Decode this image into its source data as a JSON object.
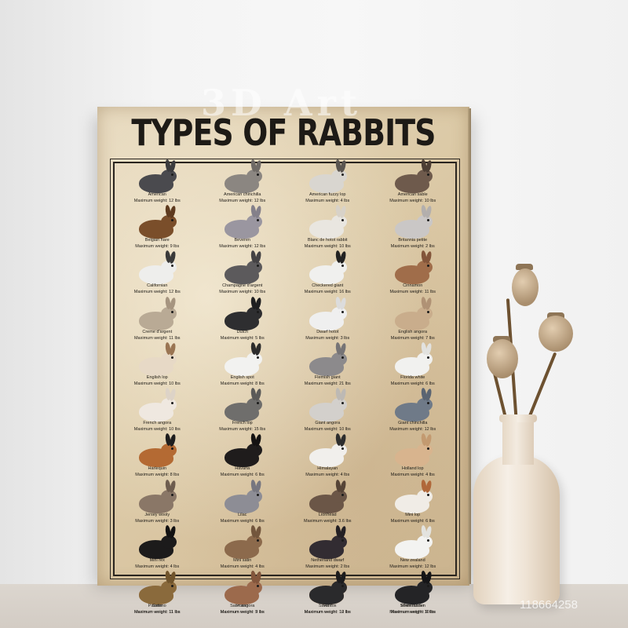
{
  "poster": {
    "title": "TYPES OF RABBITS",
    "rabbits": [
      {
        "name": "American",
        "weight": "Maximum weight: 12 lbs",
        "color": "#4a4a4e",
        "ear": "#3b3b3e"
      },
      {
        "name": "American chinchilla",
        "weight": "Maximum weight: 12 lbs",
        "color": "#8b8681",
        "ear": "#6f6a66"
      },
      {
        "name": "American fuzzy lop",
        "weight": "Maximum weight: 4 lbs",
        "color": "#d9d6d0",
        "ear": "#5a5550"
      },
      {
        "name": "American sable",
        "weight": "Maximum weight: 10 lbs",
        "color": "#6e5a4c",
        "ear": "#4c3e34"
      },
      {
        "name": "Belgian hare",
        "weight": "Maximum weight: 9 lbs",
        "color": "#7a4e2a",
        "ear": "#5e3a1e"
      },
      {
        "name": "Beveren",
        "weight": "Maximum weight: 12 lbs",
        "color": "#9a96a0",
        "ear": "#84808a"
      },
      {
        "name": "Blanc de hotot rabbit",
        "weight": "Maximum weight: 10 lbs",
        "color": "#e9e6e0",
        "ear": "#d8d2c8"
      },
      {
        "name": "Britannia petite",
        "weight": "Maximum weight: 2 lbs",
        "color": "#cac7c6",
        "ear": "#b3afad"
      },
      {
        "name": "Californian",
        "weight": "Maximum weight: 12 lbs",
        "color": "#eeeeec",
        "ear": "#3a3a3a"
      },
      {
        "name": "Champagne d'argent",
        "weight": "Maximum weight: 10 lbs",
        "color": "#5c5a5c",
        "ear": "#444244"
      },
      {
        "name": "Checkered giant",
        "weight": "Maximum weight: 16 lbs",
        "color": "#f0f0ee",
        "ear": "#222222"
      },
      {
        "name": "Cinnamon",
        "weight": "Maximum weight: 11 lbs",
        "color": "#a06d4a",
        "ear": "#83553a"
      },
      {
        "name": "Creme d'argent",
        "weight": "Maximum weight: 11 lbs",
        "color": "#b9aa95",
        "ear": "#a69580"
      },
      {
        "name": "Dutch",
        "weight": "Maximum weight: 5 lbs",
        "color": "#2e2e30",
        "ear": "#1f1f20"
      },
      {
        "name": "Dwarf hotot",
        "weight": "Maximum weight: 3 lbs",
        "color": "#efefef",
        "ear": "#dcdcdc"
      },
      {
        "name": "English angora",
        "weight": "Maximum weight: 7 lbs",
        "color": "#c9ad8c",
        "ear": "#b09275"
      },
      {
        "name": "English lop",
        "weight": "Maximum weight: 10 lbs",
        "color": "#e7d9c6",
        "ear": "#9a7553"
      },
      {
        "name": "English spot",
        "weight": "Maximum weight: 8 lbs",
        "color": "#f2f2f0",
        "ear": "#2c2c2c"
      },
      {
        "name": "Flemish giant",
        "weight": "Maximum weight: 21 lbs",
        "color": "#8c8a8c",
        "ear": "#767476"
      },
      {
        "name": "Florida white",
        "weight": "Maximum weight: 6 lbs",
        "color": "#f1f1ef",
        "ear": "#e2e2df"
      },
      {
        "name": "French angora",
        "weight": "Maximum weight: 10 lbs",
        "color": "#efe8e0",
        "ear": "#ddd3c7"
      },
      {
        "name": "French lop",
        "weight": "Maximum weight: 15 lbs",
        "color": "#6f6e6c",
        "ear": "#5b5a58"
      },
      {
        "name": "Giant angora",
        "weight": "Maximum weight: 10 lbs",
        "color": "#d3d0cc",
        "ear": "#bdb9b4"
      },
      {
        "name": "Giant chinchilla",
        "weight": "Maximum weight: 12 lbs",
        "color": "#6f7a88",
        "ear": "#5a6472"
      },
      {
        "name": "Harlequin",
        "weight": "Maximum weight: 8 lbs",
        "color": "#b46a33",
        "ear": "#1e1e1e"
      },
      {
        "name": "Havana",
        "weight": "Maximum weight: 6 lbs",
        "color": "#1f1c1c",
        "ear": "#141212"
      },
      {
        "name": "Himalayan",
        "weight": "Maximum weight: 4 lbs",
        "color": "#f1efec",
        "ear": "#2e2e2e"
      },
      {
        "name": "Holland lop",
        "weight": "Maximum weight: 4 lbs",
        "color": "#d8b48e",
        "ear": "#c39a70"
      },
      {
        "name": "Jersey wooly",
        "weight": "Maximum weight: 3 lbs",
        "color": "#8a7767",
        "ear": "#6e5d4f"
      },
      {
        "name": "Lilac",
        "weight": "Maximum weight: 6 lbs",
        "color": "#8d8d95",
        "ear": "#777780"
      },
      {
        "name": "Lionhead",
        "weight": "Maximum weight: 3.6 lbs",
        "color": "#6b5647",
        "ear": "#564437"
      },
      {
        "name": "Mini lop",
        "weight": "Maximum weight: 6 lbs",
        "color": "#f0ece6",
        "ear": "#b0683a"
      },
      {
        "name": "Mini rex",
        "weight": "Maximum weight: 4 lbs",
        "color": "#1c1b1b",
        "ear": "#121111"
      },
      {
        "name": "Mini satin",
        "weight": "Maximum weight: 4 lbs",
        "color": "#8c6a4c",
        "ear": "#73563d"
      },
      {
        "name": "Netherland dwarf",
        "weight": "Maximum weight: 2 lbs",
        "color": "#322c32",
        "ear": "#242024"
      },
      {
        "name": "New zealand",
        "weight": "Maximum weight: 12 lbs",
        "color": "#f3f3f1",
        "ear": "#e3e3df"
      },
      {
        "name": "Palomino",
        "weight": "Maximum weight: 11 lbs",
        "color": "#c08c58",
        "ear": "#a57444"
      },
      {
        "name": "Polish",
        "weight": "Maximum weight: 3 lbs",
        "color": "#f2f2f2",
        "ear": "#222222"
      },
      {
        "name": "Rex",
        "weight": "Maximum weight: 10 lbs",
        "color": "#d6904e",
        "ear": "#bb783d"
      },
      {
        "name": "Rhinelander",
        "weight": "Maximum weight: 10 lbs",
        "color": "#e9e9e7",
        "ear": "#2a2a2a"
      },
      {
        "name": "Satin",
        "weight": "Maximum weight: 11 lbs",
        "color": "#8a6a3c",
        "ear": "#70542c"
      },
      {
        "name": "Satin angora",
        "weight": "Maximum weight: 9 lbs",
        "color": "#9c6a4c",
        "ear": "#83563c"
      },
      {
        "name": "Silver fox",
        "weight": "Maximum weight: 12 lbs",
        "color": "#2a2a2c",
        "ear": "#1c1c1e"
      },
      {
        "name": "Silver marten",
        "weight": "Maximum weight: 9 lbs",
        "color": "#242426",
        "ear": "#151517"
      }
    ]
  },
  "watermarks": {
    "brand": "3D Art",
    "id": "118664258"
  }
}
